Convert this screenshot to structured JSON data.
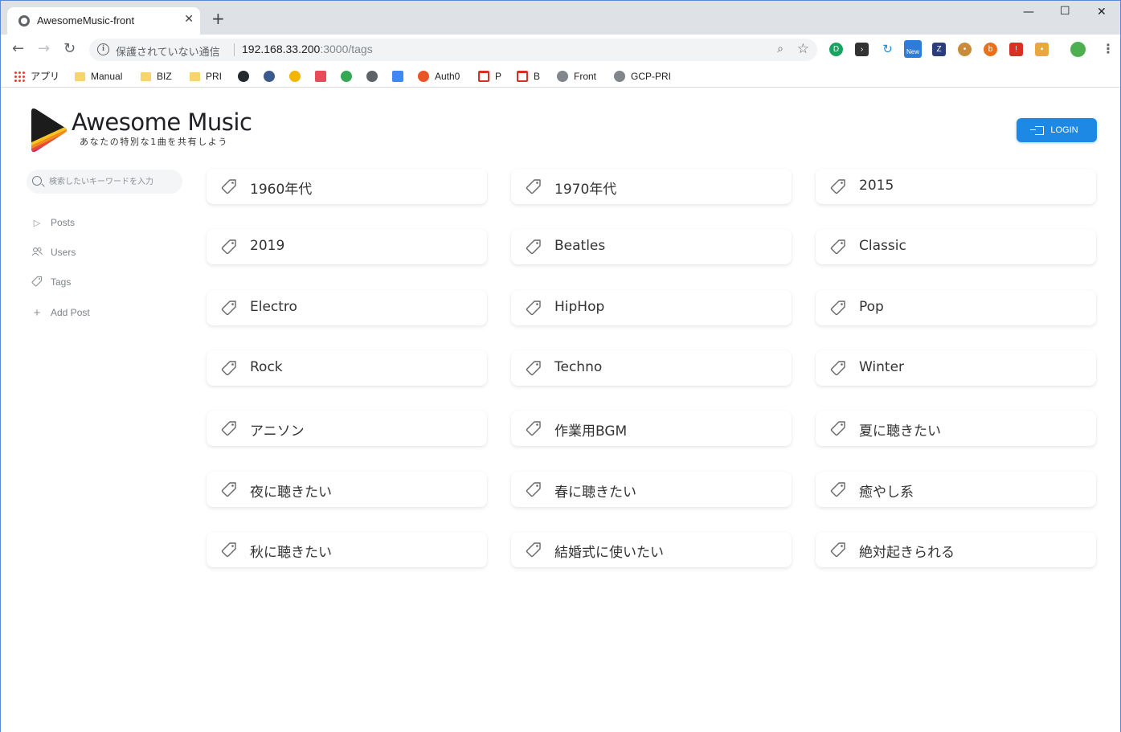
{
  "browser": {
    "tab_title": "AwesomeMusic-front",
    "tab_close": "✕",
    "new_tab": "+",
    "security_text": "保護されていない通信",
    "url_host": "192.168.33.200",
    "url_path": ":3000/tags",
    "bookmarks": [
      {
        "label": "アプリ",
        "icon": "apps-icon"
      },
      {
        "label": "Manual",
        "icon": "folder-icon"
      },
      {
        "label": "BIZ",
        "icon": "folder-icon"
      },
      {
        "label": "PRI",
        "icon": "folder-icon"
      },
      {
        "label": "",
        "icon": "github-icon"
      },
      {
        "label": "",
        "icon": "bird-icon"
      },
      {
        "label": "",
        "icon": "co-icon"
      },
      {
        "label": "",
        "icon": "qiita-icon"
      },
      {
        "label": "",
        "icon": "ac-icon"
      },
      {
        "label": "",
        "icon": "wave-icon"
      },
      {
        "label": "",
        "icon": "calendar-icon"
      },
      {
        "label": "Auth0",
        "icon": "auth0-icon"
      },
      {
        "label": "P",
        "icon": "gmail-icon"
      },
      {
        "label": "B",
        "icon": "gmail-icon"
      },
      {
        "label": "Front",
        "icon": "globe-icon"
      },
      {
        "label": "GCP-PRI",
        "icon": "gcp-icon"
      }
    ],
    "extensions_new_badge": "New"
  },
  "app": {
    "brand": "Awesome Music",
    "tagline": "あなたの特別な1曲を共有しよう",
    "login_label": "LOGIN",
    "search_placeholder": "検索したいキーワードを入力",
    "nav": [
      {
        "label": "Posts",
        "icon": "play-icon"
      },
      {
        "label": "Users",
        "icon": "users-icon"
      },
      {
        "label": "Tags",
        "icon": "tag-icon"
      },
      {
        "label": "Add Post",
        "icon": "plus-icon"
      }
    ],
    "tags": [
      "1960年代",
      "1970年代",
      "2015",
      "2019",
      "Beatles",
      "Classic",
      "Electro",
      "HipHop",
      "Pop",
      "Rock",
      "Techno",
      "Winter",
      "アニソン",
      "作業用BGM",
      "夏に聴きたい",
      "夜に聴きたい",
      "春に聴きたい",
      "癒やし系",
      "秋に聴きたい",
      "結婚式に使いたい",
      "絶対起きられる"
    ],
    "colors": {
      "accent": "#1e88e5",
      "text": "#333333",
      "muted": "#7c8288"
    }
  }
}
